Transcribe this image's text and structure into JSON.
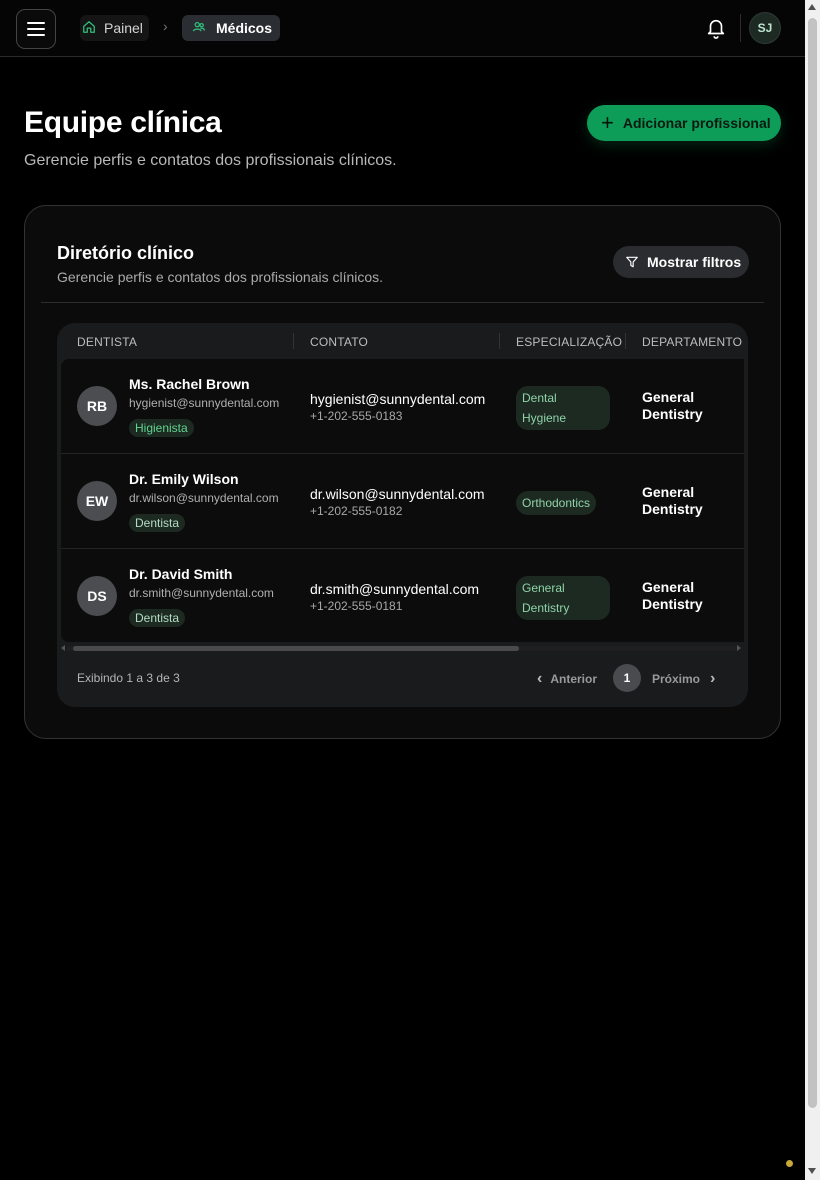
{
  "breadcrumb": {
    "home": "Painel",
    "current": "Médicos"
  },
  "user": {
    "initials": "SJ"
  },
  "page": {
    "title": "Equipe clínica",
    "subtitle": "Gerencie perfis e contatos dos profissionais clínicos.",
    "add_button": "Adicionar profissional"
  },
  "directory": {
    "title": "Diretório clínico",
    "subtitle": "Gerencie perfis e contatos dos profissionais clínicos.",
    "filter_button": "Mostrar filtros",
    "columns": [
      "DENTISTA",
      "CONTATO",
      "ESPECIALIZAÇÃO",
      "DEPARTAMENTO"
    ],
    "rows": [
      {
        "initials": "RB",
        "name": "Ms. Rachel Brown",
        "email": "hygienist@sunnydental.com",
        "role": "Higienista",
        "contact_email": "hygienist@sunnydental.com",
        "phone": "+1-202-555-0183",
        "spec_line1": "Dental",
        "spec_line2": "Hygiene",
        "dept_line1": "General",
        "dept_line2": "Dentistry"
      },
      {
        "initials": "EW",
        "name": "Dr. Emily Wilson",
        "email": "dr.wilson@sunnydental.com",
        "role": "Dentista",
        "contact_email": "dr.wilson@sunnydental.com",
        "phone": "+1-202-555-0182",
        "spec_line1": "Orthodontics",
        "spec_line2": "",
        "dept_line1": "General",
        "dept_line2": "Dentistry"
      },
      {
        "initials": "DS",
        "name": "Dr. David Smith",
        "email": "dr.smith@sunnydental.com",
        "role": "Dentista",
        "contact_email": "dr.smith@sunnydental.com",
        "phone": "+1-202-555-0181",
        "spec_line1": "General",
        "spec_line2": "Dentistry",
        "dept_line1": "General",
        "dept_line2": "Dentistry"
      }
    ],
    "footer": {
      "showing": "Exibindo 1 a 3 de 3",
      "prev": "Anterior",
      "page": "1",
      "next": "Próximo"
    }
  },
  "colors": {
    "accent": "#0e9d59",
    "accent_text": "#2fbf7a",
    "badge_bg": "#1d2a22"
  }
}
